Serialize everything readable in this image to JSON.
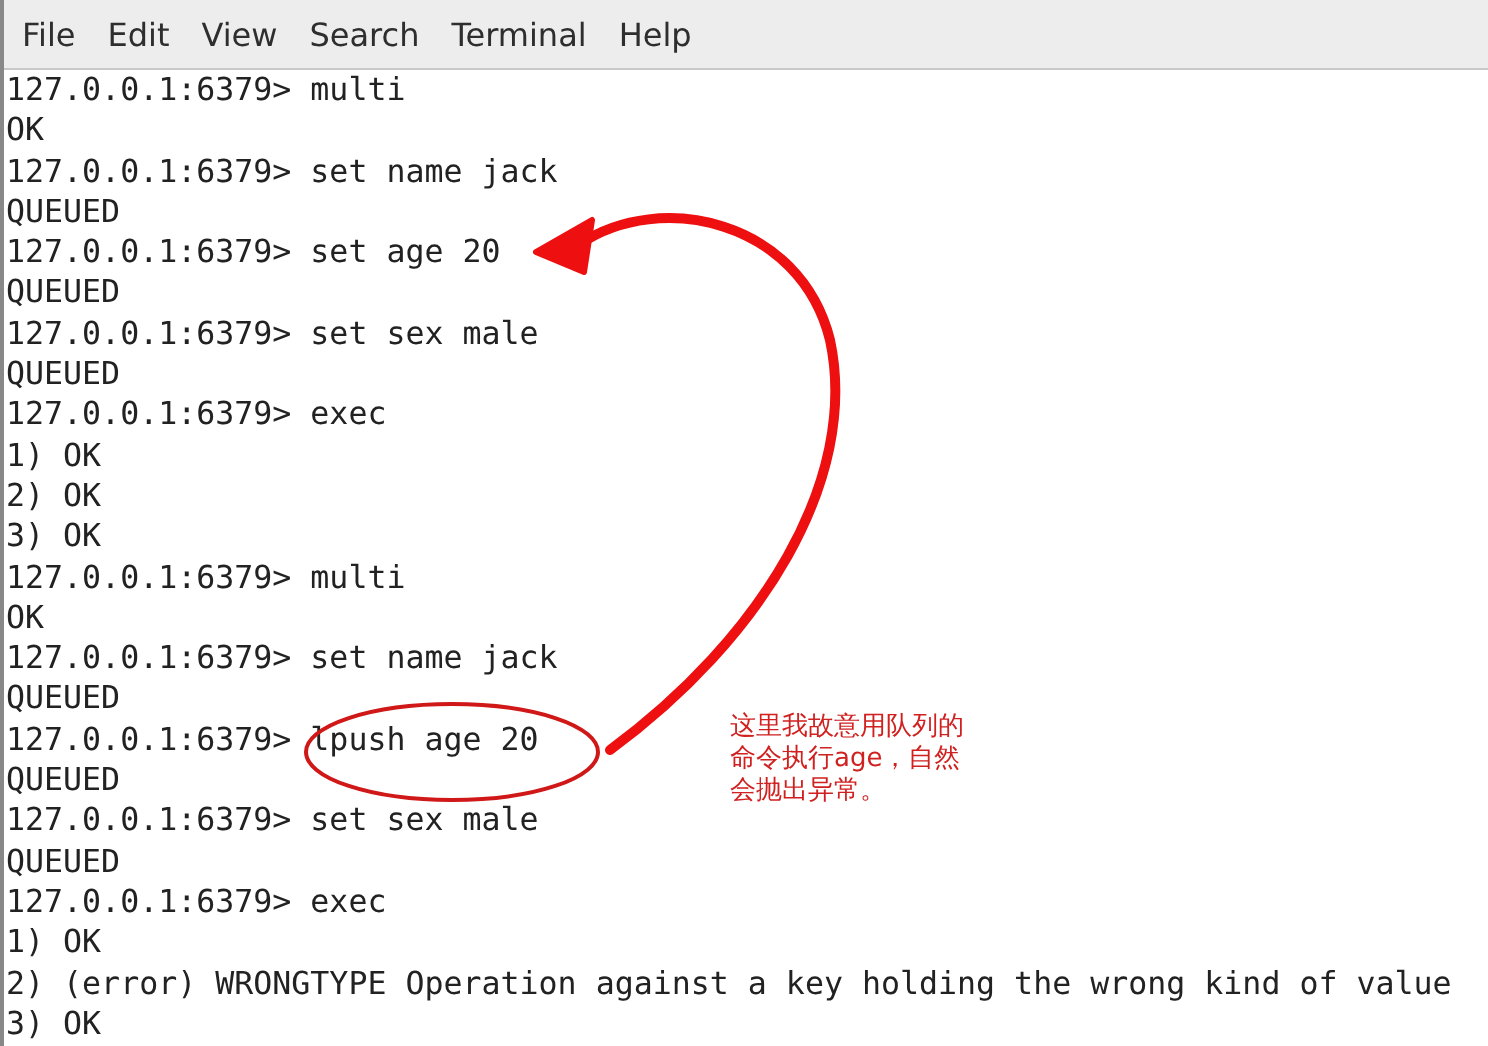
{
  "menu": [
    "File",
    "Edit",
    "View",
    "Search",
    "Terminal",
    "Help"
  ],
  "terminal_lines": [
    "127.0.0.1:6379> multi",
    "OK",
    "127.0.0.1:6379> set name jack",
    "QUEUED",
    "127.0.0.1:6379> set age 20",
    "QUEUED",
    "127.0.0.1:6379> set sex male",
    "QUEUED",
    "127.0.0.1:6379> exec",
    "1) OK",
    "2) OK",
    "3) OK",
    "127.0.0.1:6379> multi",
    "OK",
    "127.0.0.1:6379> set name jack",
    "QUEUED",
    "127.0.0.1:6379> lpush age 20",
    "QUEUED",
    "127.0.0.1:6379> set sex male",
    "QUEUED",
    "127.0.0.1:6379> exec",
    "1) OK",
    "2) (error) WRONGTYPE Operation against a key holding the wrong kind of value",
    "3) OK"
  ],
  "annotation": {
    "note_lines": [
      "这里我故意用队列的",
      "命令执行age，自然",
      "会抛出异常。"
    ]
  }
}
